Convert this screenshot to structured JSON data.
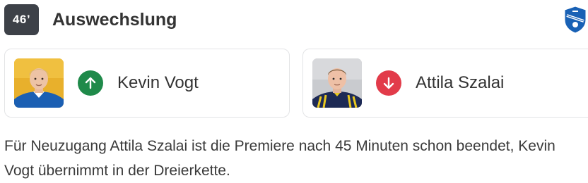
{
  "event": {
    "minute": "46’",
    "title": "Auswechslung",
    "club_logo_icon": "tsg-hoffenheim-crest-icon"
  },
  "substitution": {
    "player_in": {
      "name": "Kevin Vogt",
      "direction_icon": "arrow-up-icon",
      "direction_color": "#1f8a4a"
    },
    "player_out": {
      "name": "Attila Szalai",
      "direction_icon": "arrow-down-icon",
      "direction_color": "#e23b4a"
    }
  },
  "commentary": {
    "text": "Für Neuzugang Attila Szalai ist die Premiere nach 45 Minuten schon beendet, Kevin Vogt übernimmt in der Dreierkette."
  }
}
